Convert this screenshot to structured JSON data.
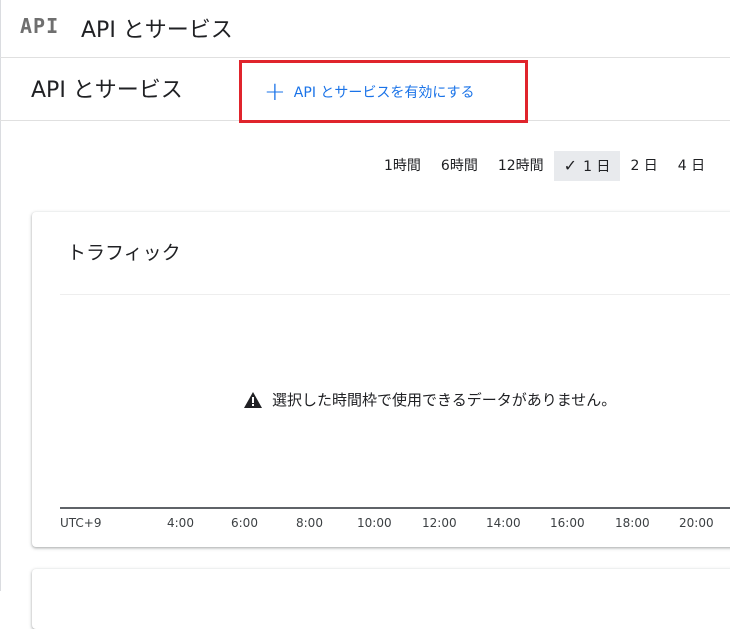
{
  "header": {
    "logo_text": "API",
    "title": "API とサービス"
  },
  "subheader": {
    "page_title": "API とサービス",
    "enable_button_label": "API とサービスを有効にする"
  },
  "time_range": {
    "options": [
      "1時間",
      "6時間",
      "12時間",
      "1 日",
      "2 日",
      "4 日"
    ],
    "selected": "1 日"
  },
  "traffic_card": {
    "title": "トラフィック",
    "no_data_message": "選択した時間枠で使用できるデータがありません。",
    "x_axis": {
      "timezone_label": "UTC+9",
      "ticks": [
        "4:00",
        "6:00",
        "8:00",
        "10:00",
        "12:00",
        "14:00",
        "16:00",
        "18:00",
        "20:00"
      ]
    }
  },
  "colors": {
    "accent": "#1a73e8",
    "highlight_border": "#e0242c",
    "selected_bg": "#e8eaed"
  }
}
